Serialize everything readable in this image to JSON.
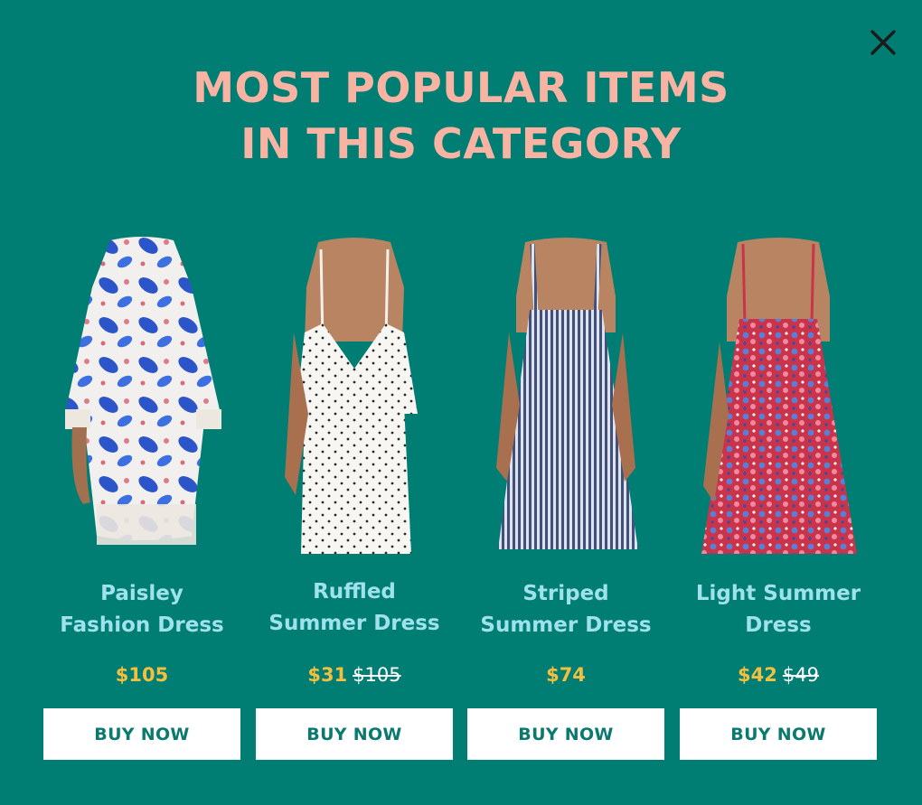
{
  "popup": {
    "title_line1": "MOST POPULAR ITEMS",
    "title_line2": "IN THIS CATEGORY",
    "close_icon": "close-icon"
  },
  "colors": {
    "background": "#007e73",
    "title": "#f8b3a3",
    "product_name": "#9fe1ec",
    "price": "#f2c03e",
    "button_text": "#0a7a6e"
  },
  "products": [
    {
      "name_line1": "Paisley",
      "name_line2": "Fashion Dress",
      "price": "$105",
      "old_price": "",
      "button_label": "BUY NOW",
      "image": "paisley-dress-image"
    },
    {
      "name_line1": "Ruffled",
      "name_line2": "Summer Dress",
      "price": "$31",
      "old_price": "$105",
      "button_label": "BUY NOW",
      "image": "ruffled-dress-image"
    },
    {
      "name_line1": "Striped",
      "name_line2": "Summer Dress",
      "price": "$74",
      "old_price": "",
      "button_label": "BUY NOW",
      "image": "striped-dress-image"
    },
    {
      "name_line1": "Light Summer",
      "name_line2": "Dress",
      "price": "$42",
      "old_price": "$49",
      "button_label": "BUY NOW",
      "image": "floral-dress-image"
    }
  ]
}
